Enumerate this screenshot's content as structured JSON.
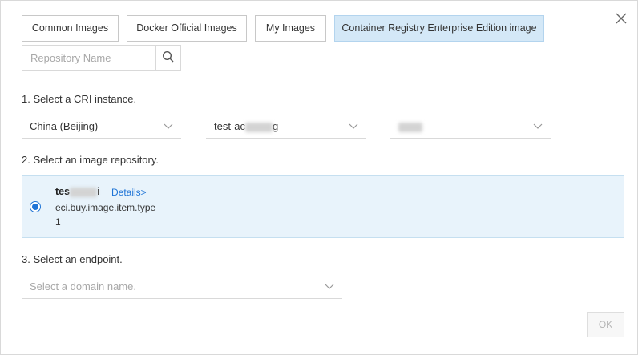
{
  "tabs": [
    {
      "label": "Common Images",
      "active": false
    },
    {
      "label": "Docker Official Images",
      "active": false
    },
    {
      "label": "My Images",
      "active": false
    },
    {
      "label": "Container Registry Enterprise Edition image",
      "active": true
    }
  ],
  "search": {
    "placeholder": "Repository Name",
    "value": ""
  },
  "steps": {
    "instance_label": "1. Select a CRI instance.",
    "repository_label": "2. Select an image repository.",
    "endpoint_label": "3. Select an endpoint."
  },
  "selects": {
    "region": "China (Beijing)",
    "instance_prefix": "test-ac",
    "instance_suffix": "g"
  },
  "repository": {
    "name_prefix": "tes",
    "name_suffix": "i",
    "details_label": "Details>",
    "type": "eci.buy.image.item.type",
    "count": "1",
    "selected": true
  },
  "endpoint": {
    "placeholder": "Select a domain name."
  },
  "footer": {
    "ok_label": "OK",
    "ok_disabled": true
  },
  "colors": {
    "accent": "#1f74d6",
    "active_tab_bg": "#d4e8f7",
    "selected_row_bg": "#e8f3fb"
  }
}
